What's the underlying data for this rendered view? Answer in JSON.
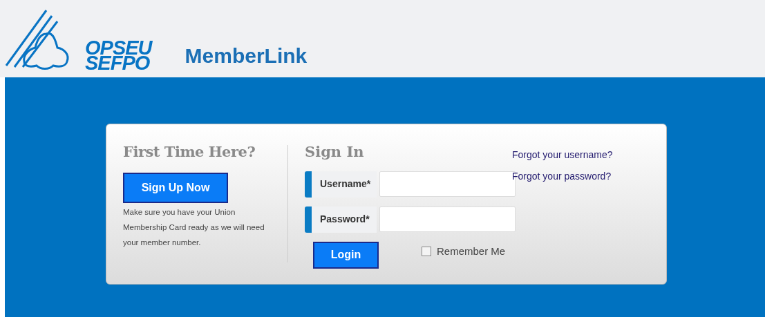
{
  "header": {
    "logo_line_1": "OPSEU",
    "logo_line_2": "SEFPO",
    "title": "MemberLink"
  },
  "first_time": {
    "heading": "First Time Here?",
    "button": "Sign Up Now",
    "note": "Make sure you have your Union Membership Card ready as we will need your member number."
  },
  "sign_in": {
    "heading": "Sign In",
    "fields": [
      {
        "label": "Username*"
      },
      {
        "label": "Password*"
      }
    ],
    "button": "Login",
    "remember": {
      "label": "Remember Me",
      "checked": false
    }
  },
  "links": [
    "Forgot your username?",
    "Forgot your password?"
  ]
}
